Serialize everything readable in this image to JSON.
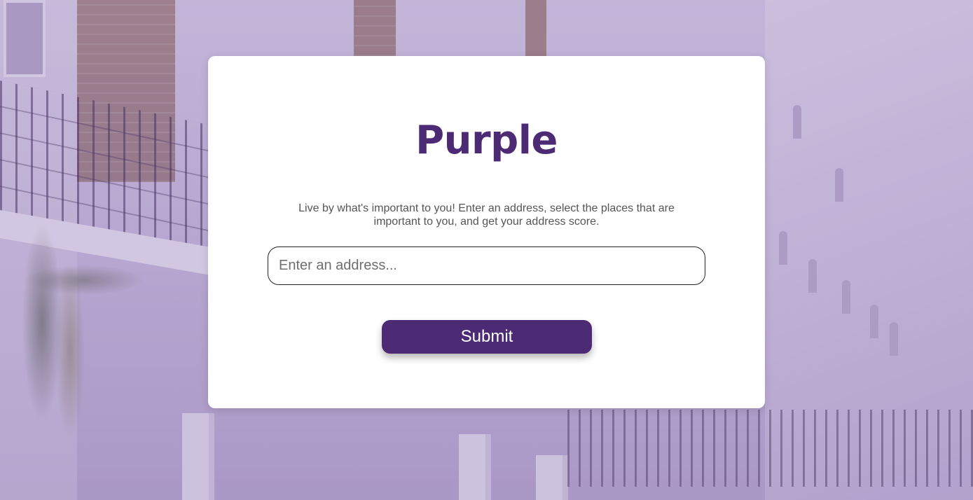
{
  "app": {
    "brand": "Purple",
    "tagline": "Live by what's important to you! Enter an address, select the places that are important to you, and get your address score."
  },
  "form": {
    "address_placeholder": "Enter an address...",
    "address_value": "",
    "submit_label": "Submit"
  },
  "colors": {
    "brand": "#4d2a74",
    "card_background": "#ffffff",
    "tagline_text": "#555555"
  },
  "background": {
    "image": "building-facade-photo"
  }
}
